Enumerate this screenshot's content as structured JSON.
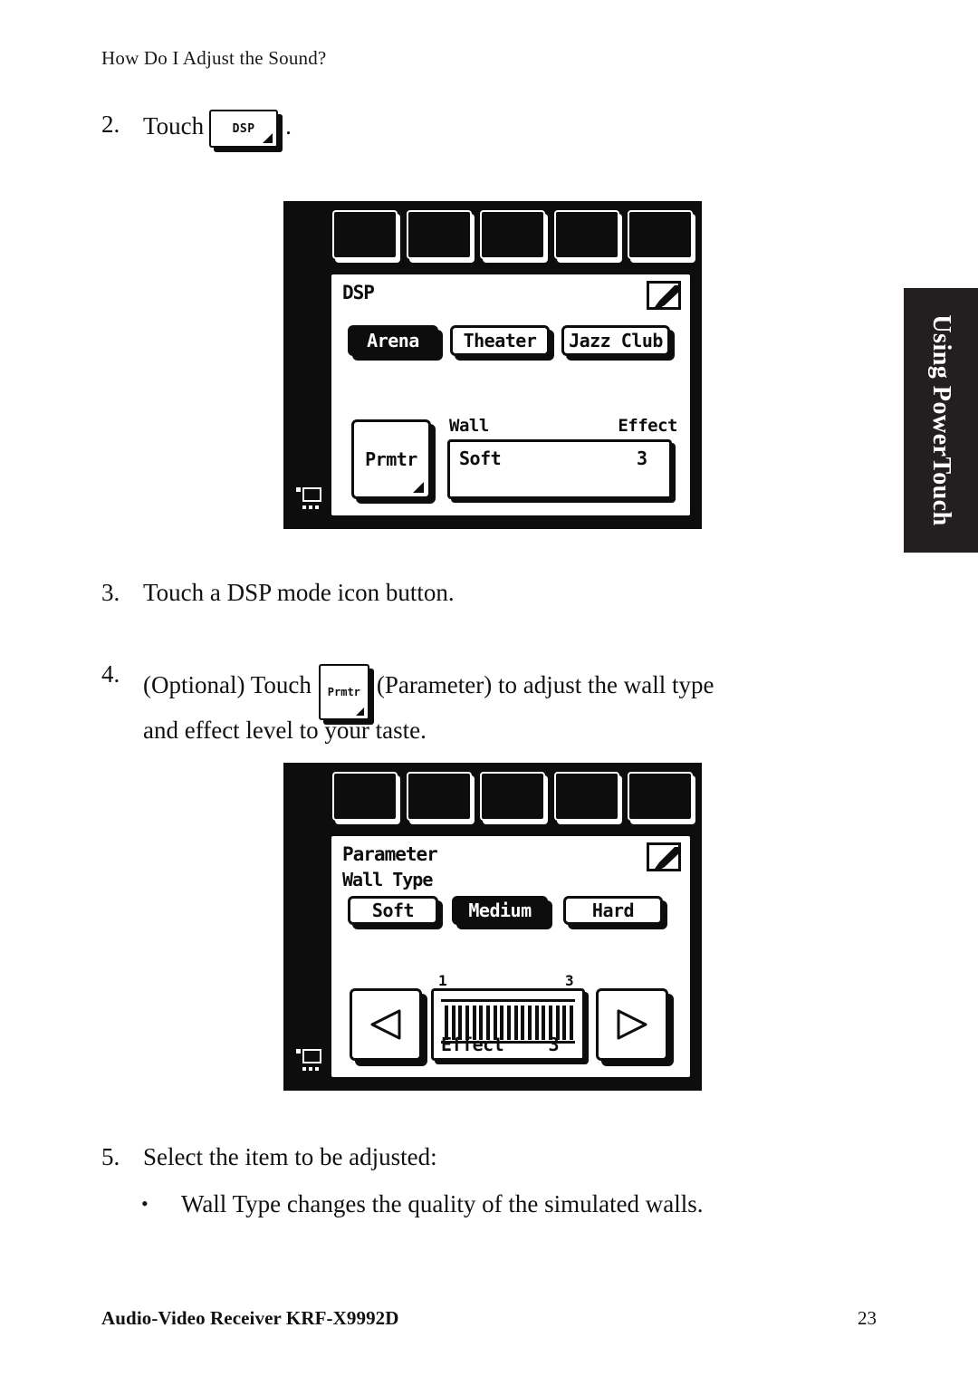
{
  "page": {
    "running_head": "How Do I Adjust the Sound?",
    "footer_text": "Audio-Video Receiver KRF-X9992D",
    "page_number": "23"
  },
  "side_tab": {
    "label": "Using PowerTouch",
    "background": "#231f20",
    "text_color": "#ffffff"
  },
  "steps": {
    "step2": {
      "number": "2.",
      "text_before": "Touch",
      "key_label": "DSP",
      "text_after": "."
    },
    "step3": {
      "number": "3.",
      "text": "Touch a DSP mode icon button."
    },
    "step4": {
      "number": "4.",
      "text_before": "(Optional) Touch",
      "key_label": "Prmtr",
      "text_after": "(Parameter) to adjust the wall type",
      "line2": "and effect level to your taste."
    },
    "step5": {
      "number": "5.",
      "text": "Select the item to be adjusted:",
      "bullet": "•",
      "bullet_text": "Wall Type changes the quality of the simulated walls."
    }
  },
  "device_dsp": {
    "function_keys": [
      "",
      "",
      "",
      "",
      ""
    ],
    "bezel_icon": "monitor-icon",
    "screen": {
      "title": "DSP",
      "edit_icon": "pencil-icon",
      "mode_buttons": [
        {
          "label": "Arena",
          "selected": true
        },
        {
          "label": "Theater",
          "selected": false
        },
        {
          "label": "Jazz Club",
          "selected": false
        }
      ],
      "param_button": {
        "label": "Prmtr",
        "has_corner_marker": true
      },
      "readout": {
        "label_left": "Wall",
        "label_right": "Effect",
        "value_left": "Soft",
        "value_right": "3"
      }
    }
  },
  "device_parameter": {
    "function_keys": [
      "",
      "",
      "",
      "",
      ""
    ],
    "bezel_icon": "monitor-icon",
    "screen": {
      "title": "Parameter",
      "edit_icon": "pencil-icon",
      "section_label": "Wall Type",
      "wall_type_buttons": [
        {
          "label": "Soft",
          "selected": false
        },
        {
          "label": "Medium",
          "selected": true
        },
        {
          "label": "Hard",
          "selected": false
        }
      ],
      "left_arrow": "left-triangle-icon",
      "right_arrow": "right-triangle-icon",
      "meter": {
        "scale_min": "1",
        "scale_max": "3",
        "label": "Effect",
        "value": "3",
        "bar_count": 19
      }
    }
  }
}
